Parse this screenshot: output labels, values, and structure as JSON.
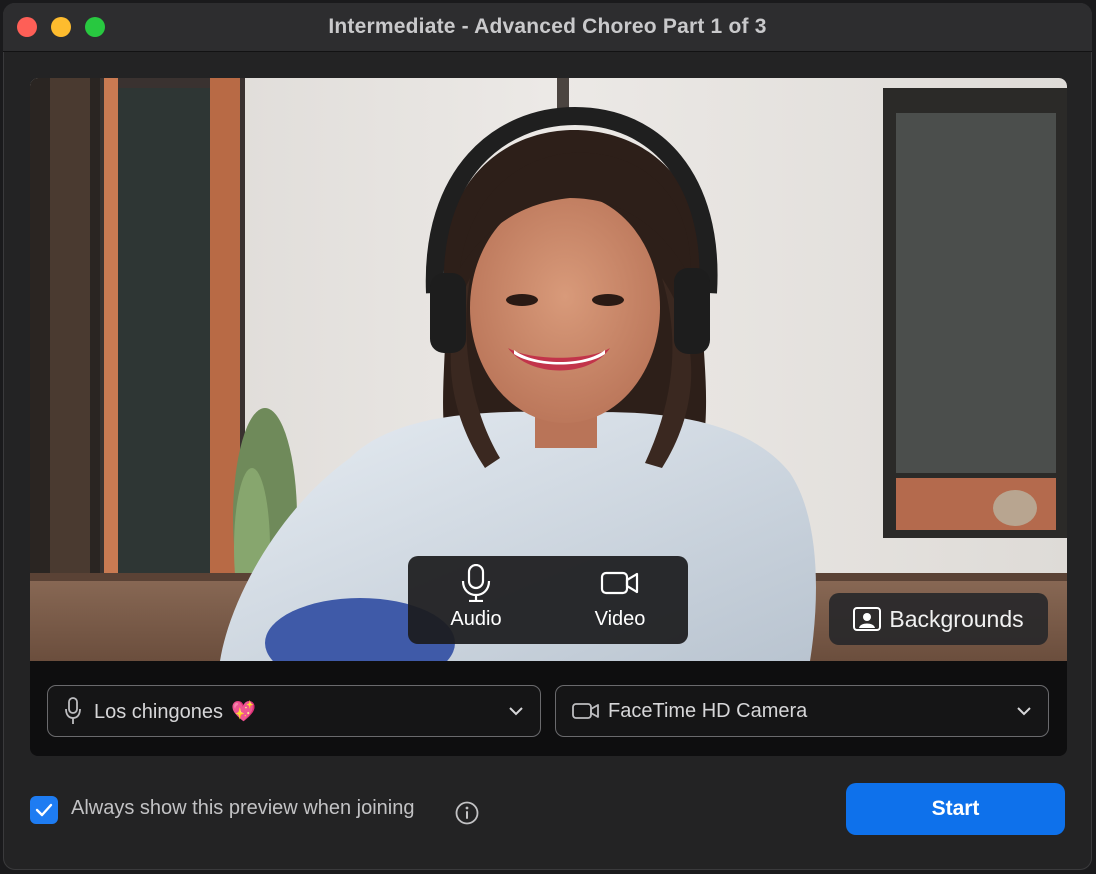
{
  "window": {
    "title": "Intermediate - Advanced Choreo Part 1 of 3",
    "controls": [
      "close-button",
      "minimize-button",
      "maximize-button"
    ]
  },
  "preview": {
    "audio_label": "Audio",
    "video_label": "Video",
    "audio_icon": "microphone-icon",
    "video_icon": "video-camera-icon",
    "backgrounds_label": "Backgrounds",
    "backgrounds_icon": "background-portrait-icon"
  },
  "devices": {
    "microphone": {
      "selected": "Los chingones",
      "emoji": "💖",
      "icon": "microphone-icon"
    },
    "camera": {
      "selected": "FaceTime HD Camera",
      "icon": "video-camera-icon"
    }
  },
  "footer": {
    "always_show_preview_label": "Always show this preview when joining",
    "always_show_preview_checked": true,
    "start_label": "Start"
  },
  "colors": {
    "accent": "#0e71eb",
    "checkbox": "#1e7cf2",
    "window_bg": "#232324",
    "close": "#fe5f57",
    "minimize": "#febc2e",
    "maximize": "#28c840"
  }
}
